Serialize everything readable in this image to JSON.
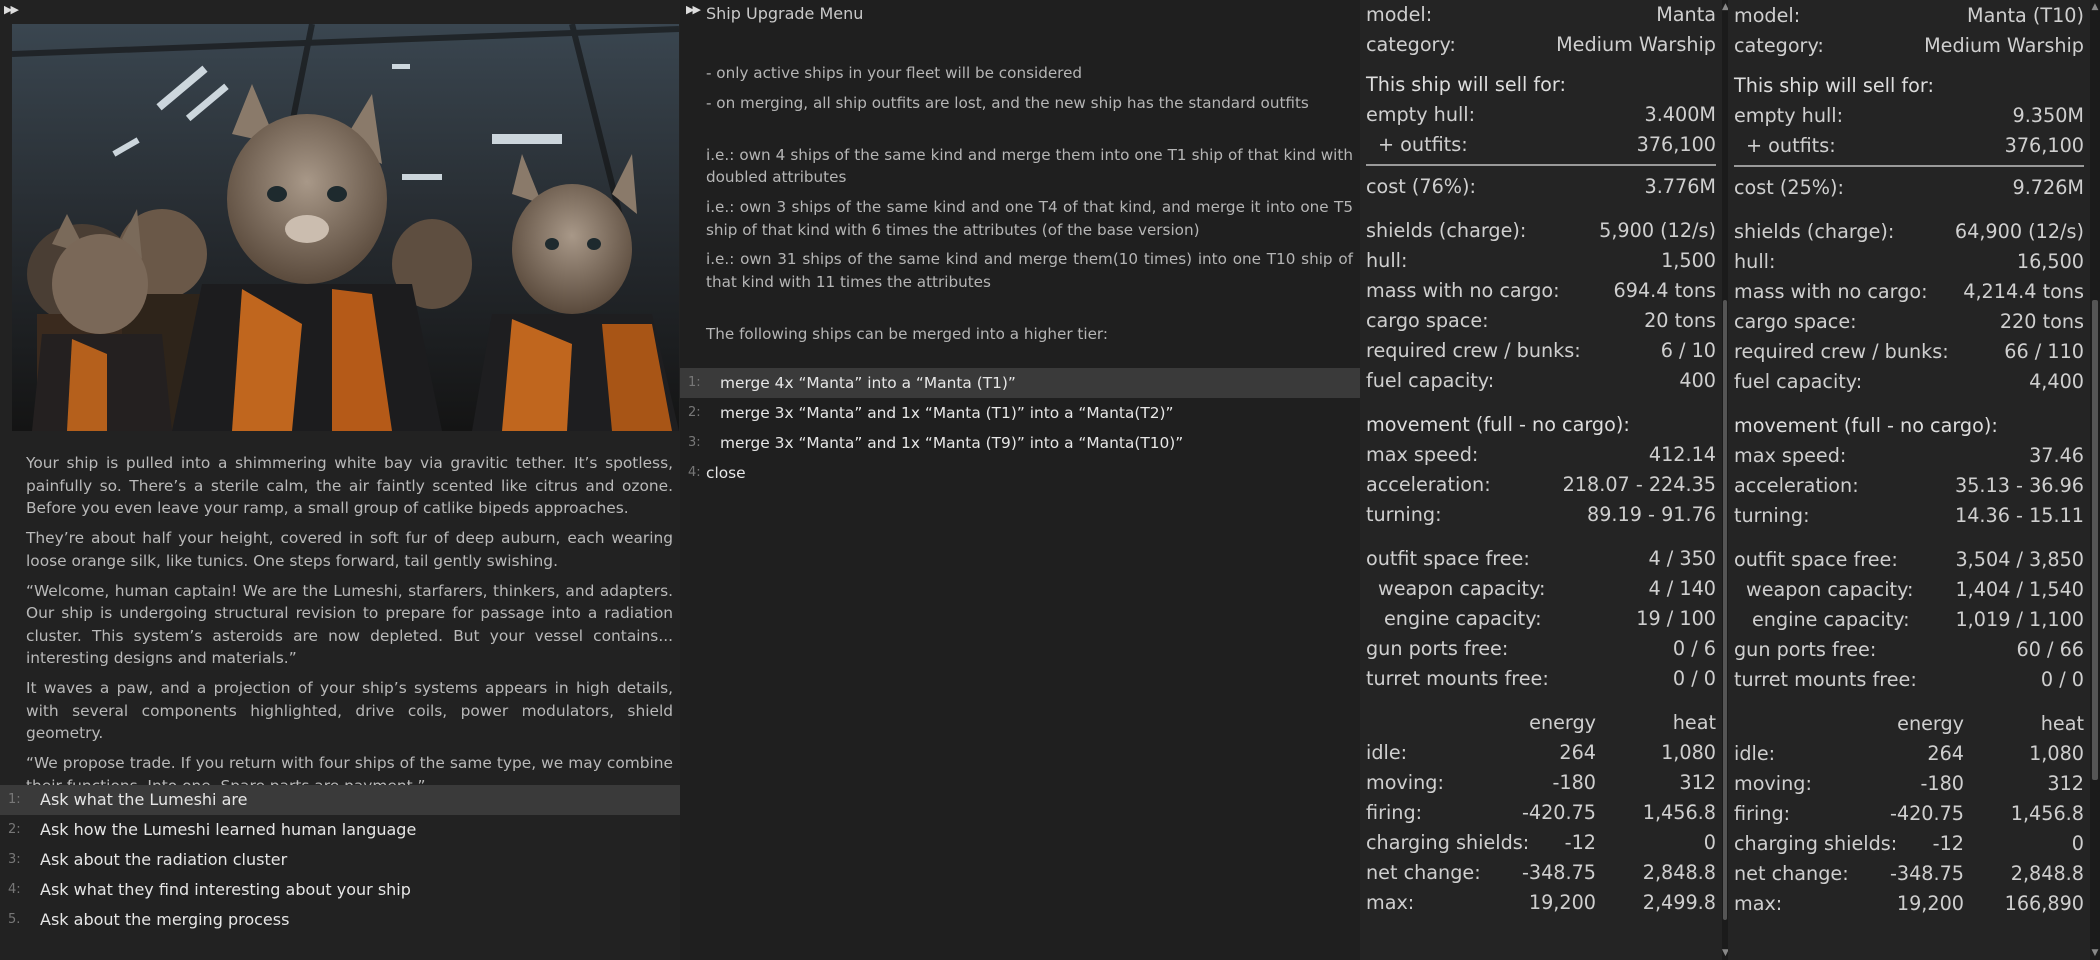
{
  "story_panel": {
    "paragraphs": [
      "Your ship is pulled into a shimmering white bay via gravitic tether. It’s spotless, painfully so. There’s a sterile calm, the air faintly scented like citrus and ozone. Before you even leave your ramp, a small group of catlike bipeds approaches.",
      "They’re about half your height, covered in soft fur of deep auburn, each wearing loose orange silk, like tunics. One steps forward, tail gently swishing.",
      "“Welcome, human captain! We are the Lumeshi, starfarers, thinkers, and adapters. Our ship is undergoing structural revision to prepare for passage into a radiation cluster. This system’s asteroids are now depleted. But your vessel contains... interesting designs and materials.”",
      "It waves a paw, and a projection of your ship’s systems appears in high details, with several components highlighted, drive coils, power modulators, shield geometry.",
      "“We propose trade. If you return with four ships of the same type, we may combine their functions. Into one. Spare parts are payment.”"
    ],
    "choices": [
      {
        "num": "1:",
        "label": "Ask what the Lumeshi are"
      },
      {
        "num": "2:",
        "label": "Ask how the Lumeshi learned human language"
      },
      {
        "num": "3:",
        "label": "Ask about the radiation cluster"
      },
      {
        "num": "4:",
        "label": "Ask what they find interesting about your ship"
      },
      {
        "num": "5.",
        "label": "Ask about the merging process"
      }
    ]
  },
  "upgrade_menu": {
    "title": "Ship Upgrade Menu",
    "notes": [
      "- only active ships in your fleet will be considered",
      "- on merging, all ship outfits are lost, and the new ship has the standard outfits",
      "i.e.: own 4 ships of the same kind and merge them into one T1 ship of that kind with doubled attributes",
      "i.e.: own 3 ships of the same kind and one T4 of that kind, and merge it into one T5 ship of that kind with 6 times the attributes (of the base version)",
      "i.e.: own 31 ships of the same kind and merge them(10 times) into one T10 ship of that kind with 11 times the attributes",
      "The following ships can be merged into a higher tier:"
    ],
    "choices": [
      {
        "num": "1:",
        "label": "merge 4x “Manta” into a “Manta (T1)”"
      },
      {
        "num": "2:",
        "label": "merge 3x “Manta” and 1x “Manta (T1)” into a “Manta(T2)”"
      },
      {
        "num": "3:",
        "label": "merge 3x “Manta” and 1x “Manta (T9)” into a “Manta(T10)”"
      },
      {
        "num": "4:",
        "label": "close"
      }
    ]
  },
  "stats_left": {
    "model_label": "model:",
    "model": "Manta",
    "category_label": "category:",
    "category": "Medium Warship",
    "sell_heading": "This ship will sell for:",
    "empty_hull_label": "empty hull:",
    "empty_hull": "3.400M",
    "outfits_label": "+ outfits:",
    "outfits": "376,100",
    "cost_label": "cost (76%):",
    "cost": "3.776M",
    "shields_label": "shields (charge):",
    "shields": "5,900 (12/s)",
    "hull_label": "hull:",
    "hull": "1,500",
    "mass_label": "mass with no cargo:",
    "mass": "694.4 tons",
    "cargo_label": "cargo space:",
    "cargo": "20 tons",
    "crew_label": "required crew / bunks:",
    "crew": "6 / 10",
    "fuel_label": "fuel capacity:",
    "fuel": "400",
    "movement_heading": "movement (full - no cargo):",
    "max_speed_label": "max speed:",
    "max_speed": "412.14",
    "accel_label": "acceleration:",
    "accel": "218.07 - 224.35",
    "turning_label": "turning:",
    "turning": "89.19 - 91.76",
    "outfit_space_label": "outfit space free:",
    "outfit_space": "4 / 350",
    "weapon_cap_label": "weapon capacity:",
    "weapon_cap": "4 / 140",
    "engine_cap_label": "engine capacity:",
    "engine_cap": "19 / 100",
    "gun_ports_label": "gun ports free:",
    "gun_ports": "0 / 6",
    "turret_label": "turret mounts free:",
    "turret": "0 / 0",
    "energy_heading": "energy",
    "heat_heading": "heat",
    "table": [
      {
        "label": "idle:",
        "energy": "264",
        "heat": "1,080"
      },
      {
        "label": "moving:",
        "energy": "-180",
        "heat": "312"
      },
      {
        "label": "firing:",
        "energy": "-420.75",
        "heat": "1,456.8"
      },
      {
        "label": "charging shields:",
        "energy": "-12",
        "heat": "0"
      },
      {
        "label": "net change:",
        "energy": "-348.75",
        "heat": "2,848.8"
      },
      {
        "label": "max:",
        "energy": "19,200",
        "heat": "2,499.8"
      }
    ]
  },
  "stats_right": {
    "model_label": "model:",
    "model": "Manta (T10)",
    "category_label": "category:",
    "category": "Medium Warship",
    "sell_heading": "This ship will sell for:",
    "empty_hull_label": "empty hull:",
    "empty_hull": "9.350M",
    "outfits_label": "+ outfits:",
    "outfits": "376,100",
    "cost_label": "cost (25%):",
    "cost": "9.726M",
    "shields_label": "shields (charge):",
    "shields": "64,900 (12/s)",
    "hull_label": "hull:",
    "hull": "16,500",
    "mass_label": "mass with no cargo:",
    "mass": "4,214.4 tons",
    "cargo_label": "cargo space:",
    "cargo": "220 tons",
    "crew_label": "required crew / bunks:",
    "crew": "66 / 110",
    "fuel_label": "fuel capacity:",
    "fuel": "4,400",
    "movement_heading": "movement (full - no cargo):",
    "max_speed_label": "max speed:",
    "max_speed": "37.46",
    "accel_label": "acceleration:",
    "accel": "35.13 - 36.96",
    "turning_label": "turning:",
    "turning": "14.36 - 15.11",
    "outfit_space_label": "outfit space free:",
    "outfit_space": "3,504 / 3,850",
    "weapon_cap_label": "weapon capacity:",
    "weapon_cap": "1,404 / 1,540",
    "engine_cap_label": "engine capacity:",
    "engine_cap": "1,019 / 1,100",
    "gun_ports_label": "gun ports free:",
    "gun_ports": "60 / 66",
    "turret_label": "turret mounts free:",
    "turret": "0 / 0",
    "energy_heading": "energy",
    "heat_heading": "heat",
    "table": [
      {
        "label": "idle:",
        "energy": "264",
        "heat": "1,080"
      },
      {
        "label": "moving:",
        "energy": "-180",
        "heat": "312"
      },
      {
        "label": "firing:",
        "energy": "-420.75",
        "heat": "1,456.8"
      },
      {
        "label": "charging shields:",
        "energy": "-12",
        "heat": "0"
      },
      {
        "label": "net change:",
        "energy": "-348.75",
        "heat": "2,848.8"
      },
      {
        "label": "max:",
        "energy": "19,200",
        "heat": "166,890"
      }
    ]
  }
}
